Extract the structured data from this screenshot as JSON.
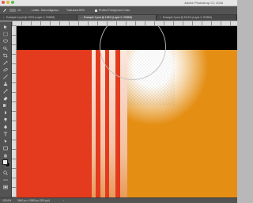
{
  "window": {
    "title": "Adobe Photoshop CC 2018"
  },
  "options_bar": {
    "brush_size": "15",
    "mode": "Limits:",
    "mode_value": "Discontiguous",
    "tolerance_label": "Tolerance:",
    "tolerance_value": "50%",
    "protect_label": "Protect Foreground Color"
  },
  "tabs": [
    {
      "label": "Example 4.psd @ 100% (Layer 1, RGB/8)",
      "active": false
    },
    {
      "label": "Example 2.psd @ 184% (Layer 0, RGB/8)",
      "active": true
    },
    {
      "label": "Example 3.psd @ 93.6% (Layer 0, RGB/8)",
      "active": false
    }
  ],
  "status_bar": {
    "zoom": "183.6%",
    "doc_info": "3840 px x 2880 px (300 ppi)"
  },
  "tools": [
    "move-tool",
    "marquee-tool",
    "lasso-tool",
    "quick-select-tool",
    "crop-tool",
    "eyedropper-tool",
    "healing-brush-tool",
    "brush-tool",
    "clone-stamp-tool",
    "history-brush-tool",
    "eraser-tool",
    "gradient-tool",
    "blur-tool",
    "dodge-tool",
    "pen-tool",
    "type-tool",
    "path-select-tool",
    "rectangle-tool",
    "hand-tool",
    "zoom-tool",
    "more-tools"
  ],
  "colors": {
    "canvas_red": "#e43a1d",
    "canvas_orange": "#e48f14",
    "canvas_black": "#000000",
    "foreground_swatch": "#f1f1f1",
    "background_swatch": "#111111"
  }
}
